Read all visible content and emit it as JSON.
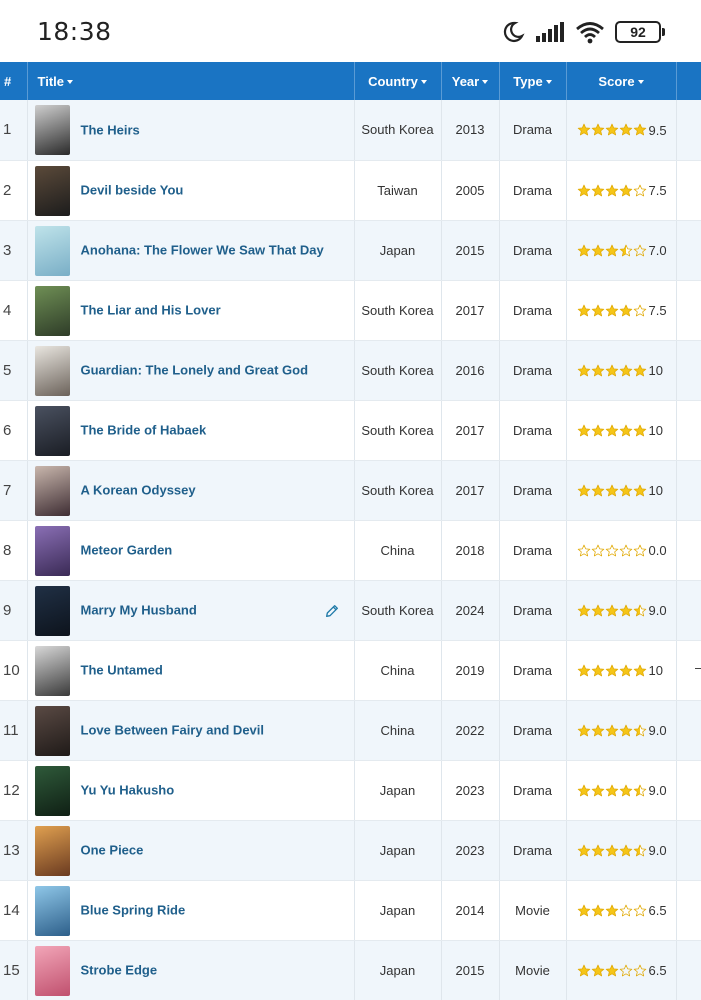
{
  "status_bar": {
    "time": "18:38",
    "battery": "92"
  },
  "colors": {
    "header": "#1a74c3",
    "link": "#1f5f8b",
    "star": "#f5c518"
  },
  "columns": {
    "num": "#",
    "title": "Title",
    "country": "Country",
    "year": "Year",
    "type": "Type",
    "score": "Score"
  },
  "rows": [
    {
      "num": "1",
      "title": "The Heirs",
      "country": "South Korea",
      "year": "2013",
      "type": "Drama",
      "score": "9.5",
      "rating": 5,
      "poster": [
        "#cfcfcf",
        "#2a2a2a"
      ]
    },
    {
      "num": "2",
      "title": "Devil beside You",
      "country": "Taiwan",
      "year": "2005",
      "type": "Drama",
      "score": "7.5",
      "rating": 4,
      "poster": [
        "#5b4a3a",
        "#1c1c1c"
      ]
    },
    {
      "num": "3",
      "title": "Anohana: The Flower We Saw That Day",
      "country": "Japan",
      "year": "2015",
      "type": "Drama",
      "score": "7.0",
      "rating": 3.5,
      "poster": [
        "#bfe3ea",
        "#79aec6"
      ]
    },
    {
      "num": "4",
      "title": "The Liar and His Lover",
      "country": "South Korea",
      "year": "2017",
      "type": "Drama",
      "score": "7.5",
      "rating": 4,
      "poster": [
        "#6f8f55",
        "#2e3c28"
      ]
    },
    {
      "num": "5",
      "title": "Guardian: The Lonely and Great God",
      "country": "South Korea",
      "year": "2016",
      "type": "Drama",
      "score": "10",
      "rating": 5,
      "poster": [
        "#e9e6e0",
        "#6b625a"
      ]
    },
    {
      "num": "6",
      "title": "The Bride of Habaek",
      "country": "South Korea",
      "year": "2017",
      "type": "Drama",
      "score": "10",
      "rating": 5,
      "poster": [
        "#4a5160",
        "#1a1d24"
      ]
    },
    {
      "num": "7",
      "title": "A Korean Odyssey",
      "country": "South Korea",
      "year": "2017",
      "type": "Drama",
      "score": "10",
      "rating": 5,
      "poster": [
        "#c9b7ad",
        "#3e2d33"
      ]
    },
    {
      "num": "8",
      "title": "Meteor Garden",
      "country": "China",
      "year": "2018",
      "type": "Drama",
      "score": "0.0",
      "rating": 0,
      "poster": [
        "#8a6fb5",
        "#3a2a55"
      ]
    },
    {
      "num": "9",
      "title": "Marry My Husband",
      "country": "South Korea",
      "year": "2024",
      "type": "Drama",
      "score": "9.0",
      "rating": 4.5,
      "poster": [
        "#203045",
        "#0d131c"
      ]
    },
    {
      "num": "10",
      "title": "The Untamed",
      "country": "China",
      "year": "2019",
      "type": "Drama",
      "score": "10",
      "rating": 5,
      "poster": [
        "#d8d8d8",
        "#3a3a3a"
      ]
    },
    {
      "num": "11",
      "title": "Love Between Fairy and Devil",
      "country": "China",
      "year": "2022",
      "type": "Drama",
      "score": "9.0",
      "rating": 4.5,
      "poster": [
        "#5a4a44",
        "#1f1a18"
      ]
    },
    {
      "num": "12",
      "title": "Yu Yu Hakusho",
      "country": "Japan",
      "year": "2023",
      "type": "Drama",
      "score": "9.0",
      "rating": 4.5,
      "poster": [
        "#2f5a3a",
        "#0f1f14"
      ]
    },
    {
      "num": "13",
      "title": "One Piece",
      "country": "Japan",
      "year": "2023",
      "type": "Drama",
      "score": "9.0",
      "rating": 4.5,
      "poster": [
        "#e0a050",
        "#6a3a20"
      ]
    },
    {
      "num": "14",
      "title": "Blue Spring Ride",
      "country": "Japan",
      "year": "2014",
      "type": "Movie",
      "score": "6.5",
      "rating": 3,
      "poster": [
        "#8fc7e8",
        "#2d5f8a"
      ]
    },
    {
      "num": "15",
      "title": "Strobe Edge",
      "country": "Japan",
      "year": "2015",
      "type": "Movie",
      "score": "6.5",
      "rating": 3,
      "poster": [
        "#f2a6b8",
        "#c0506e"
      ]
    }
  ]
}
